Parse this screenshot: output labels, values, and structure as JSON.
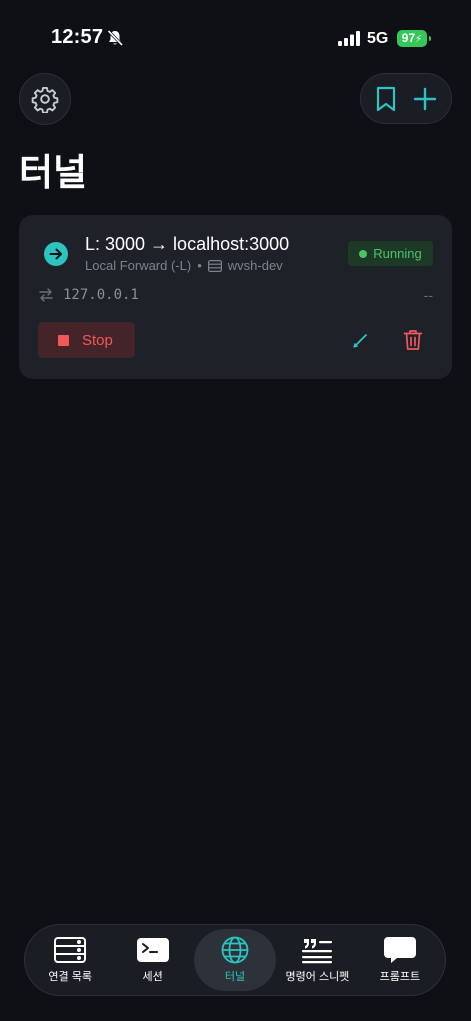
{
  "status_bar": {
    "time": "12:57",
    "network": "5G",
    "battery": "97"
  },
  "header": {
    "title": "터널"
  },
  "tunnel": {
    "title": "L: 3000 → localhost:3000",
    "type": "Local Forward (-L)",
    "separator": "•",
    "server": "wvsh-dev",
    "status": "Running",
    "bind_address": "127.0.0.1",
    "traffic": "--",
    "stop_label": "Stop"
  },
  "tabs": [
    {
      "label": "연결 목록",
      "icon": "server-list-icon"
    },
    {
      "label": "세션",
      "icon": "terminal-icon"
    },
    {
      "label": "터널",
      "icon": "globe-icon",
      "active": true
    },
    {
      "label": "명령어 스니펫",
      "icon": "quote-list-icon"
    },
    {
      "label": "프롬프트",
      "icon": "chat-bubble-icon"
    }
  ],
  "colors": {
    "accent": "#2ec3c0",
    "running": "#4ec267",
    "stop": "#f0585c",
    "background": "#0e1016",
    "card": "#1e2128"
  }
}
